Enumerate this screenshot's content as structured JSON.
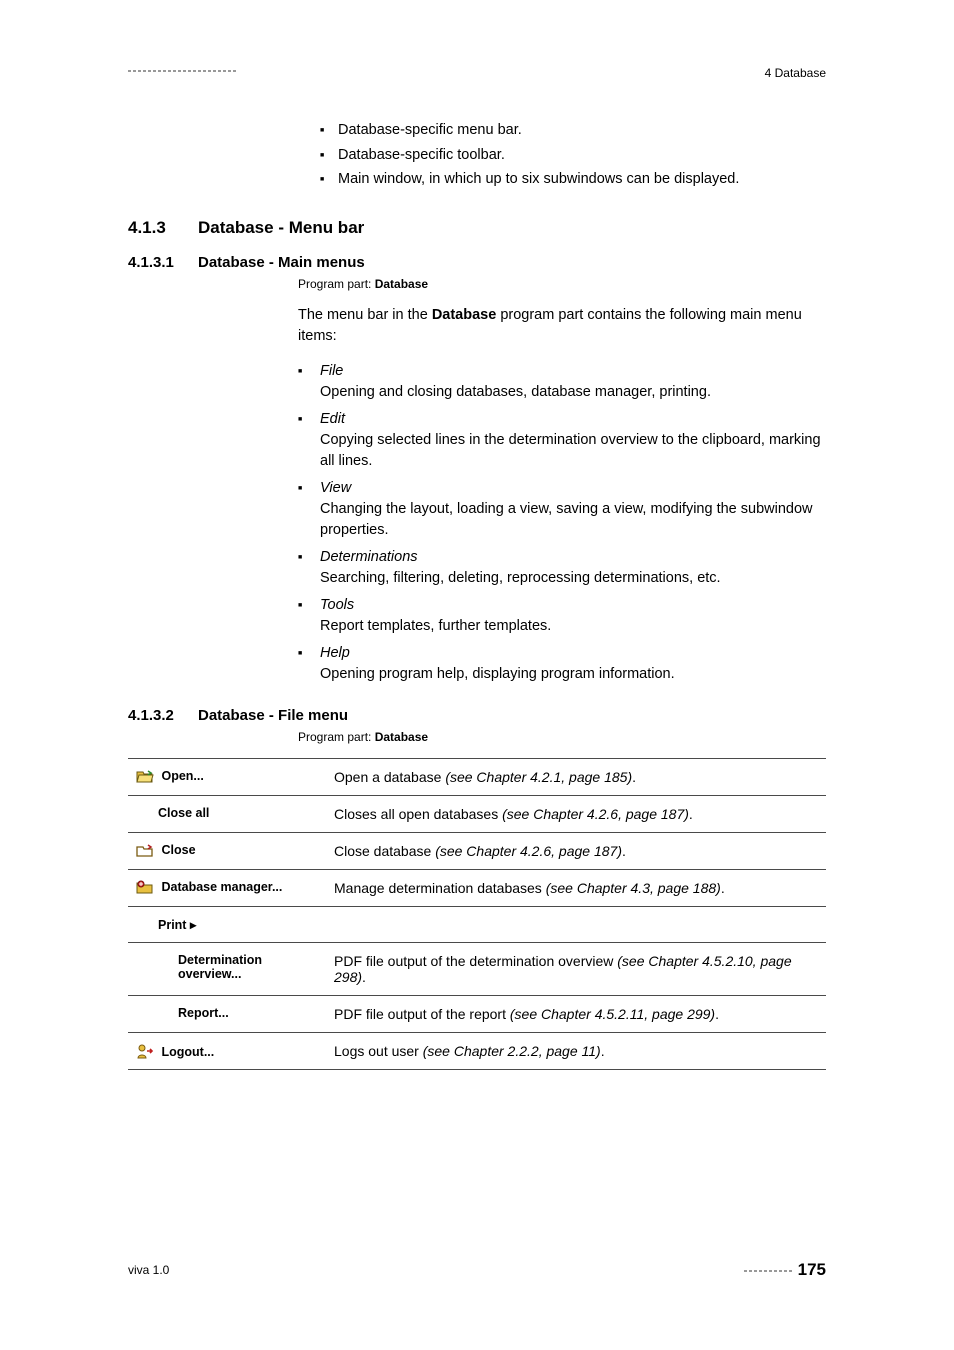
{
  "header": {
    "right": "4 Database"
  },
  "intro_bullets": [
    "Database-specific menu bar.",
    "Database-specific toolbar.",
    "Main window, in which up to six subwindows can be displayed."
  ],
  "s413": {
    "num": "4.1.3",
    "title": "Database - Menu bar"
  },
  "s4131": {
    "num": "4.1.3.1",
    "title": "Database - Main menus",
    "pp_label": "Program part: ",
    "pp_val": "Database",
    "para_a": "The menu bar in the ",
    "para_b": "Database",
    "para_c": " program part contains the following main menu items:",
    "menus": [
      {
        "name": "File",
        "desc": "Opening and closing databases, database manager, printing."
      },
      {
        "name": "Edit",
        "desc": "Copying selected lines in the determination overview to the clipboard, marking all lines."
      },
      {
        "name": "View",
        "desc": "Changing the layout, loading a view, saving a view, modifying the subwindow properties."
      },
      {
        "name": "Determinations",
        "desc": "Searching, filtering, deleting, reprocessing determinations, etc."
      },
      {
        "name": "Tools",
        "desc": "Report templates, further templates."
      },
      {
        "name": "Help",
        "desc": "Opening program help, displaying program information."
      }
    ]
  },
  "s4132": {
    "num": "4.1.3.2",
    "title": "Database - File menu",
    "pp_label": "Program part: ",
    "pp_val": "Database",
    "rows": {
      "open": {
        "label": "Open...",
        "desc_a": "Open a database ",
        "desc_b": "(see Chapter 4.2.1, page 185)",
        "desc_c": "."
      },
      "closeall": {
        "label": "Close all",
        "desc_a": "Closes all open databases ",
        "desc_b": "(see Chapter 4.2.6, page 187)",
        "desc_c": "."
      },
      "close": {
        "label": "Close",
        "desc_a": "Close database ",
        "desc_b": "(see Chapter 4.2.6, page 187)",
        "desc_c": "."
      },
      "dbmgr": {
        "label": "Database manager...",
        "desc_a": "Manage determination databases ",
        "desc_b": "(see Chapter 4.3, page 188)",
        "desc_c": "."
      },
      "print": {
        "label": "Print ▸"
      },
      "detov": {
        "label": "Determination overview...",
        "desc_a": "PDF file output of the determination overview ",
        "desc_b": "(see Chapter 4.5.2.10, page 298)",
        "desc_c": "."
      },
      "report": {
        "label": "Report...",
        "desc_a": "PDF file output of the report ",
        "desc_b": "(see Chapter 4.5.2.11, page 299)",
        "desc_c": "."
      },
      "logout": {
        "label": "Logout...",
        "desc_a": "Logs out user ",
        "desc_b": "(see Chapter 2.2.2, page 11)",
        "desc_c": "."
      }
    }
  },
  "footer": {
    "left": "viva 1.0",
    "page": "175"
  }
}
